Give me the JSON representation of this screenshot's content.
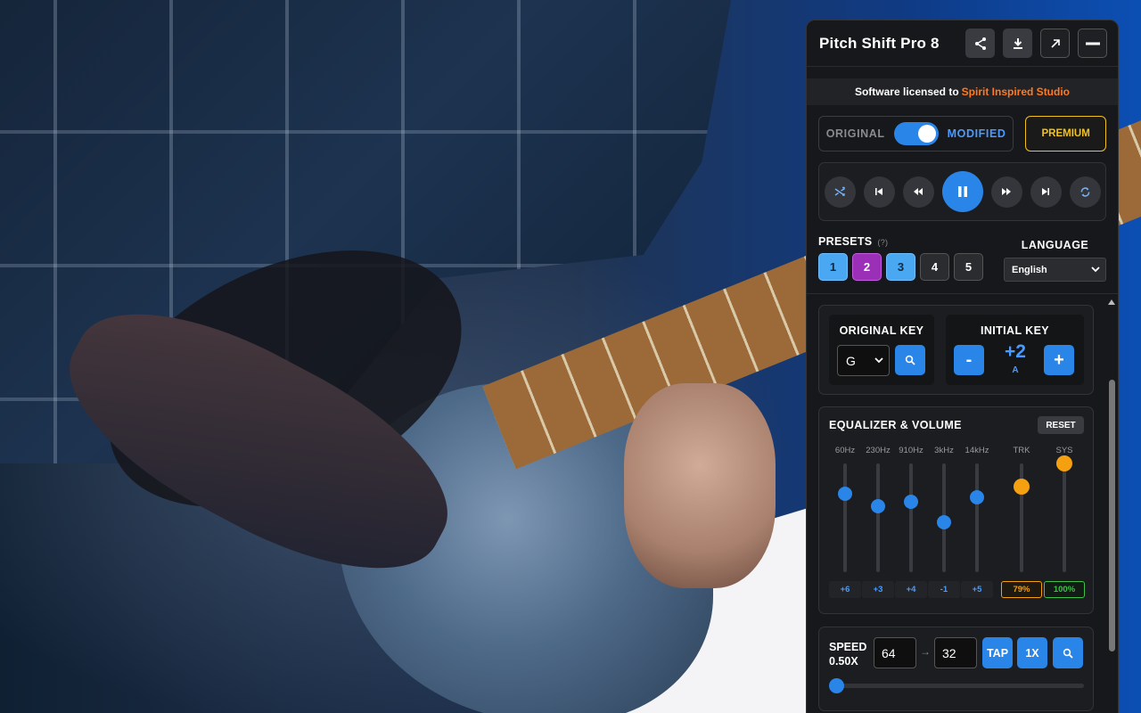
{
  "panel": {
    "title": "Pitch Shift Pro 8",
    "header_buttons": [
      "share-icon",
      "download-icon",
      "open-external-icon",
      "minimize-icon"
    ]
  },
  "license": {
    "prefix": "Software licensed to",
    "studio": "Spirit Inspired Studio"
  },
  "mode": {
    "original_label": "ORIGINAL",
    "modified_label": "MODIFIED",
    "modified_on": true
  },
  "premium_label": "PREMIUM",
  "transport": [
    "shuffle-icon",
    "skip-previous-icon",
    "rewind-icon",
    "pause-icon",
    "fast-forward-icon",
    "skip-next-icon",
    "repeat-icon"
  ],
  "presets": {
    "label": "PRESETS",
    "help": "(?)",
    "items": [
      "1",
      "2",
      "3",
      "4",
      "5"
    ]
  },
  "language": {
    "label": "LANGUAGE",
    "selected": "English"
  },
  "keys": {
    "original_title": "ORIGINAL KEY",
    "original_value": "G",
    "initial_title": "INITIAL KEY",
    "minus_label": "-",
    "plus_label": "+",
    "initial_value": "+2",
    "initial_note": "A"
  },
  "equalizer": {
    "title": "EQUALIZER & VOLUME",
    "reset_label": "RESET",
    "bands": [
      {
        "label": "60Hz",
        "value": "+6",
        "level": 0.72,
        "kind": "eq"
      },
      {
        "label": "230Hz",
        "value": "+3",
        "level": 0.61,
        "kind": "eq"
      },
      {
        "label": "910Hz",
        "value": "+4",
        "level": 0.65,
        "kind": "eq"
      },
      {
        "label": "3kHz",
        "value": "-1",
        "level": 0.46,
        "kind": "eq"
      },
      {
        "label": "14kHz",
        "value": "+5",
        "level": 0.69,
        "kind": "eq"
      },
      {
        "label": "TRK",
        "value": "79%",
        "level": 0.79,
        "kind": "trk"
      },
      {
        "label": "SYS",
        "value": "100%",
        "level": 1.0,
        "kind": "sys"
      }
    ]
  },
  "speed": {
    "label": "SPEED",
    "value_label": "0.50X",
    "from_value": "64",
    "arrow": "→",
    "to_value": "32",
    "tap_label": "TAP",
    "onex_label": "1X",
    "slider_level": 0.0
  }
}
